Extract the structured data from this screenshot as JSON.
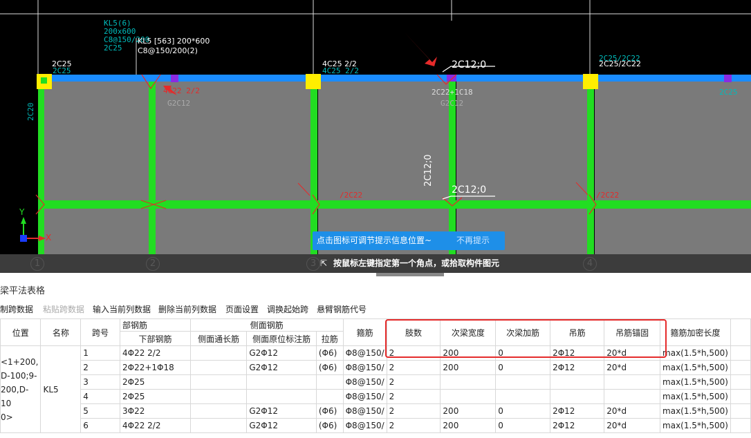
{
  "cad": {
    "beam_label_main": "KL5 [563] 200*600",
    "beam_label_stirrup": "C8@150/200(2)",
    "beam_label_left": [
      "KL5(6)",
      "200x600",
      "C8@150/200",
      "2C25"
    ],
    "support_labels": [
      "2C25",
      "4C25 2/2",
      "2C25/2C22",
      "2C25"
    ],
    "support_labels_dim": [
      "2C25",
      "4C25 2/2",
      "2C25/2C22"
    ],
    "red_label_a": "4C22 2/2",
    "red_label_b": "G2C12",
    "mid_label_a": "2C22+1C18",
    "mid_label_b": "G2C12",
    "hanger_top": "2C12;0",
    "hanger_mid": "2C12;0",
    "hanger_mid_vertical": "2C12;0",
    "red_small_1": "/2C22",
    "red_small_2": "/2C22",
    "col_side_left": "2C20",
    "axis_y": "Y",
    "axis_x": "X",
    "grid_numbers": [
      "1",
      "2",
      "3",
      "4"
    ],
    "accent_green": "#22dd22",
    "accent_blue": "#1a8cff",
    "accent_yellow": "#ffee00",
    "accent_red": "#e52a2a",
    "accent_purple": "#8a2be2"
  },
  "hint": {
    "message": "点击图标可调节提示信息位置~",
    "dismiss": "不再提示"
  },
  "status": {
    "prompt": "按鼠标左键指定第一个角点，或拾取构件图元",
    "icon": "cursor-corner-icon"
  },
  "panel": {
    "title": "梁平法表格"
  },
  "toolbar": {
    "items": [
      {
        "label": "复制跨数据",
        "enabled": true
      },
      {
        "label": "粘贴跨数据",
        "enabled": false
      },
      {
        "label": "输入当前列数据",
        "enabled": true
      },
      {
        "label": "删除当前列数据",
        "enabled": true
      },
      {
        "label": "页面设置",
        "enabled": true
      },
      {
        "label": "调换起始跨",
        "enabled": true
      },
      {
        "label": "悬臂钢筋代号",
        "enabled": true
      }
    ]
  },
  "table": {
    "headers": {
      "position": "位置",
      "name": "名称",
      "span": "跨号",
      "bottom_group": "部钢筋",
      "bottom": "下部钢筋",
      "side_group": "侧面钢筋",
      "side_through": "侧面通长筋",
      "side_in_place": "侧面原位标注筋",
      "tie": "拉筋",
      "stirrup": "箍筋",
      "legs": "肢数",
      "sub_width": "次梁宽度",
      "sub_extra": "次梁加筋",
      "hanger": "吊筋",
      "hanger_anchor": "吊筋锚固",
      "dense_length": "箍筋加密长度"
    },
    "position_text": [
      "<1+200,",
      "D-100;9-",
      "200,D-10",
      "0>"
    ],
    "name": "KL5",
    "rows": [
      {
        "span": "1",
        "bottom": "4Φ22 2/2",
        "side_through": "",
        "side_in_place": "G2Φ12",
        "tie": "(Φ6)",
        "stirrup": "Φ8@150/",
        "legs": "2",
        "sub_width": "200",
        "sub_extra": "0",
        "hanger": "2Φ12",
        "hanger_anchor": "20*d",
        "dense_length": "max(1.5*h,500)"
      },
      {
        "span": "2",
        "bottom": "2Φ22+1Φ18",
        "side_through": "",
        "side_in_place": "G2Φ12",
        "tie": "(Φ6)",
        "stirrup": "Φ8@150/",
        "legs": "2",
        "sub_width": "200",
        "sub_extra": "0",
        "hanger": "2Φ12",
        "hanger_anchor": "20*d",
        "dense_length": "max(1.5*h,500)"
      },
      {
        "span": "3",
        "bottom": "2Φ25",
        "side_through": "",
        "side_in_place": "",
        "tie": "",
        "stirrup": "Φ8@150/",
        "legs": "2",
        "sub_width": "",
        "sub_extra": "",
        "hanger": "",
        "hanger_anchor": "",
        "dense_length": "max(1.5*h,500)"
      },
      {
        "span": "4",
        "bottom": "2Φ25",
        "side_through": "",
        "side_in_place": "",
        "tie": "",
        "stirrup": "Φ8@150/",
        "legs": "2",
        "sub_width": "",
        "sub_extra": "",
        "hanger": "",
        "hanger_anchor": "",
        "dense_length": "max(1.5*h,500)"
      },
      {
        "span": "5",
        "bottom": "3Φ22",
        "side_through": "",
        "side_in_place": "G2Φ12",
        "tie": "(Φ6)",
        "stirrup": "Φ8@150/",
        "legs": "2",
        "sub_width": "200",
        "sub_extra": "0",
        "hanger": "2Φ12",
        "hanger_anchor": "20*d",
        "dense_length": "max(1.5*h,500)"
      },
      {
        "span": "6",
        "bottom": "4Φ22 2/2",
        "side_through": "",
        "side_in_place": "G2Φ12",
        "tie": "(Φ6)",
        "stirrup": "Φ8@150/",
        "legs": "2",
        "sub_width": "200",
        "sub_extra": "0",
        "hanger": "2Φ12",
        "hanger_anchor": "20*d",
        "dense_length": "max(1.5*h,500)"
      }
    ]
  }
}
